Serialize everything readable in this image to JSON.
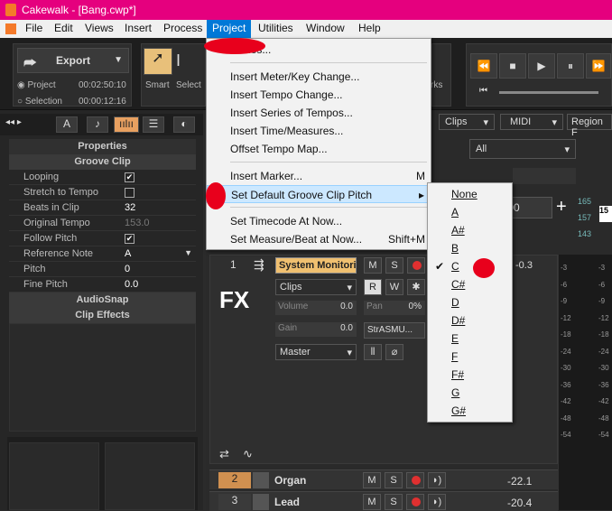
{
  "window": {
    "title": "Cakewalk - [Bang.cwp*]"
  },
  "menubar": [
    "File",
    "Edit",
    "Views",
    "Insert",
    "Process",
    "Project",
    "Utilities",
    "Window",
    "Help"
  ],
  "toolbar": {
    "export_label": "Export",
    "project_label": "Project",
    "project_time": "00:02:50:10",
    "selection_label": "Selection",
    "selection_time": "00:00:12:16",
    "smart_label": "Smart",
    "select_label": "Select",
    "clips_label": "Clips",
    "midi_label": "MIDI",
    "region_label": "Region F",
    "filter_value": "All"
  },
  "properties": {
    "header": "Properties",
    "section": "Groove Clip",
    "rows": [
      {
        "k": "Looping",
        "v": "✔",
        "type": "check"
      },
      {
        "k": "Stretch to Tempo",
        "v": "",
        "type": "check"
      },
      {
        "k": "Beats in Clip",
        "v": "32",
        "type": "text"
      },
      {
        "k": "Original Tempo",
        "v": "153.0",
        "type": "dim"
      },
      {
        "k": "Follow Pitch",
        "v": "✔",
        "type": "check"
      },
      {
        "k": "Reference Note",
        "v": "A",
        "type": "text"
      },
      {
        "k": "Pitch",
        "v": "0",
        "type": "text"
      },
      {
        "k": "Fine Pitch",
        "v": "0.0",
        "type": "text"
      }
    ],
    "audiosnap": "AudioSnap",
    "clip_effects": "Clip Effects"
  },
  "project_menu": {
    "items": [
      {
        "label": "...Files...",
        "shortcut": ""
      },
      {
        "sep": true
      },
      {
        "label": "Insert Meter/Key Change...",
        "shortcut": ""
      },
      {
        "label": "Insert Tempo Change...",
        "shortcut": ""
      },
      {
        "label": "Insert Series of Tempos...",
        "shortcut": ""
      },
      {
        "label": "Insert Time/Measures...",
        "shortcut": ""
      },
      {
        "label": "Offset Tempo Map...",
        "shortcut": ""
      },
      {
        "sep": true
      },
      {
        "label": "Insert Marker...",
        "shortcut": "M"
      },
      {
        "label": "Set Default Groove Clip Pitch",
        "shortcut": "▸",
        "hl": true
      },
      {
        "sep": true
      },
      {
        "label": "Set Timecode At Now...",
        "shortcut": ""
      },
      {
        "label": "Set Measure/Beat at Now...",
        "shortcut": "Shift+M"
      }
    ]
  },
  "pitch_submenu": {
    "items": [
      "None",
      "A",
      "A#",
      "B",
      "C",
      "C#",
      "D",
      "D#",
      "E",
      "F",
      "F#",
      "G",
      "G#"
    ],
    "checked": "C"
  },
  "tracks": [
    {
      "num": "1",
      "name": "System Monitori",
      "value": "-0.3"
    },
    {
      "num": "2",
      "name": "Organ",
      "value": "-22.1"
    },
    {
      "num": "3",
      "name": "Lead",
      "value": "-20.4"
    }
  ],
  "track1": {
    "fx_label": "FX",
    "clips_dropdown": "Clips",
    "volume_label": "Volume",
    "volume_value": "0.0",
    "pan_label": "Pan",
    "pan_value": "0%",
    "gain_label": "Gain",
    "gain_value": "0.0",
    "plugin_label": "StrASMU...",
    "output": "Master",
    "r_label": "R",
    "w_label": "W",
    "m_label": "M",
    "s_label": "S"
  },
  "tempo_readouts": {
    "a": "165",
    "b": "157",
    "c": "143",
    "d": "15",
    "value": ".00"
  },
  "meter_scale": [
    "-3",
    "-6",
    "-9",
    "-12",
    "-18",
    "-24",
    "-30",
    "-36",
    "-42",
    "-48",
    "-54"
  ],
  "colors": {
    "titlebar": "#e5007e",
    "accent": "#0078d7",
    "track_name": "#f0a030",
    "record": "#e03030"
  }
}
